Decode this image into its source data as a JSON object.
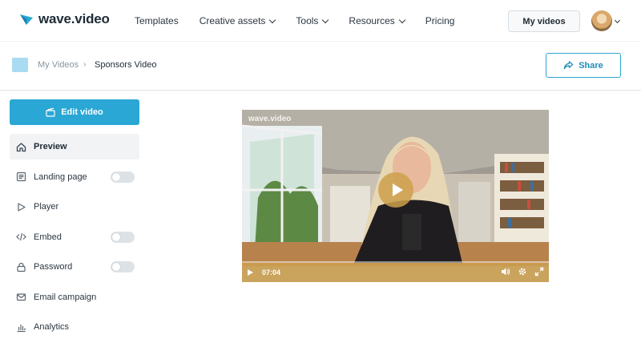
{
  "brand": {
    "name": "wave.video",
    "accent": "#2aa7d4"
  },
  "nav": {
    "items": [
      {
        "label": "Templates",
        "has_dropdown": false
      },
      {
        "label": "Creative assets",
        "has_dropdown": true
      },
      {
        "label": "Tools",
        "has_dropdown": true
      },
      {
        "label": "Resources",
        "has_dropdown": true
      },
      {
        "label": "Pricing",
        "has_dropdown": false
      }
    ],
    "my_videos_label": "My videos"
  },
  "breadcrumb": {
    "parent": "My Videos",
    "separator": "›",
    "current": "Sponsors Video"
  },
  "share_label": "Share",
  "sidebar": {
    "edit_label": "Edit video",
    "items": [
      {
        "label": "Preview",
        "icon": "home-icon",
        "active": true,
        "toggle": false
      },
      {
        "label": "Landing page",
        "icon": "page-icon",
        "active": false,
        "toggle": true
      },
      {
        "label": "Player",
        "icon": "play-icon",
        "active": false,
        "toggle": false
      },
      {
        "label": "Embed",
        "icon": "code-icon",
        "active": false,
        "toggle": true
      },
      {
        "label": "Password",
        "icon": "lock-icon",
        "active": false,
        "toggle": true
      },
      {
        "label": "Email campaign",
        "icon": "mail-icon",
        "active": false,
        "toggle": false
      },
      {
        "label": "Analytics",
        "icon": "chart-icon",
        "active": false,
        "toggle": false
      }
    ]
  },
  "player": {
    "watermark": "wave.video",
    "time": "07:04",
    "controls_color": "#cda050"
  }
}
